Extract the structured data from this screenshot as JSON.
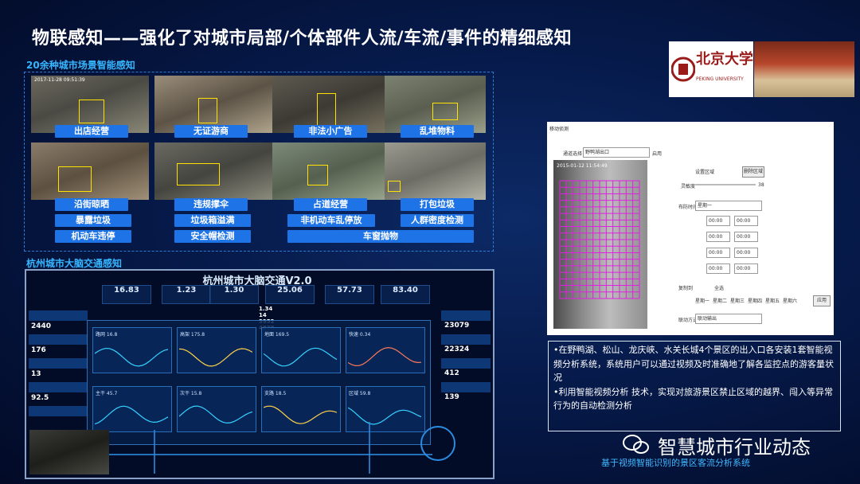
{
  "title": "物联感知——强化了对城市局部/个体部件人流/车流/事件的精细感知",
  "scenes": {
    "label": "20余种城市场景智能感知",
    "photo_ts": "2017-11-28 09:51:39",
    "tags": [
      "出店经营",
      "无证游商",
      "非法小广告",
      "乱堆物料",
      "沿街晾晒",
      "违规撑伞",
      "占道经营",
      "打包垃圾",
      "暴露垃圾",
      "垃圾箱溢满",
      "非机动车乱停放",
      "人群密度检测",
      "机动车违停",
      "安全帽检测",
      "车窗抛物"
    ]
  },
  "traffic": {
    "label": "杭州城市大脑交通感知",
    "dashboard_title": "杭州城市大脑交通V2.0",
    "metrics": [
      "16.83",
      "1.23",
      "1.30",
      "25.06",
      "57.73",
      "83.40"
    ],
    "left_values": [
      "2440",
      "176",
      "13",
      "92.5"
    ],
    "right_values": [
      "23079",
      "22324",
      "412",
      "139"
    ],
    "center_values": [
      "1.34",
      "14",
      "3952",
      "4878"
    ],
    "cards": [
      {
        "label": "路网 16.8",
        "color": "#35d1ff"
      },
      {
        "label": "高架 175.8",
        "color": "#ffd24a"
      },
      {
        "label": "地面 169.5",
        "color": "#35d1ff"
      },
      {
        "label": "快速 0.34",
        "color": "#ff7a5a"
      },
      {
        "label": "主干 45.7",
        "color": "#35d1ff"
      },
      {
        "label": "次干 15.8",
        "color": "#35d1ff"
      },
      {
        "label": "支路 18.5",
        "color": "#ffd24a"
      },
      {
        "label": "区域 59.8",
        "color": "#35d1ff"
      }
    ]
  },
  "software": {
    "header": "移动侦测",
    "channel_label": "通道选择",
    "channel_value": "野鸭湖出口",
    "enable_label": "启用",
    "draw_area": "设置区域",
    "clear_btn": "删除区域",
    "sensitivity_label": "灵敏度",
    "sensitivity_value": "38",
    "schedule_label": "布防时间",
    "schedule_value": "星期一",
    "time_slots": [
      "00:00",
      "00:00",
      "00:00",
      "00:00"
    ],
    "time_end": [
      "00:00",
      "00:00",
      "00:00",
      "00:00"
    ],
    "copy_label": "复制到",
    "copy_all": "全选",
    "days": [
      "星期一",
      "星期二",
      "星期三",
      "星期四",
      "星期五",
      "星期六"
    ],
    "apply_btn": "应用",
    "linkage_label": "联动方式",
    "linkage_value": "联动输出",
    "cam_ts": "2015-01-12 11:54:49"
  },
  "notes": [
    "•在野鸭湖、松山、龙庆峡、水关长城4个景区的出入口各安装1套智能视频分析系统，系统用户可以通过视频及时准确地了解各监控点的游客量状况",
    "•利用智能视频分析 技术，实现对旅游景区禁止区域的越界、闯入等异常行为的自动检测分析"
  ],
  "logo": {
    "name": "北京大学",
    "en": "PEKING UNIVERSITY"
  },
  "brand": {
    "name": "智慧城市行业动态",
    "subtitle": "基于视频智能识别的景区客流分析系统"
  }
}
